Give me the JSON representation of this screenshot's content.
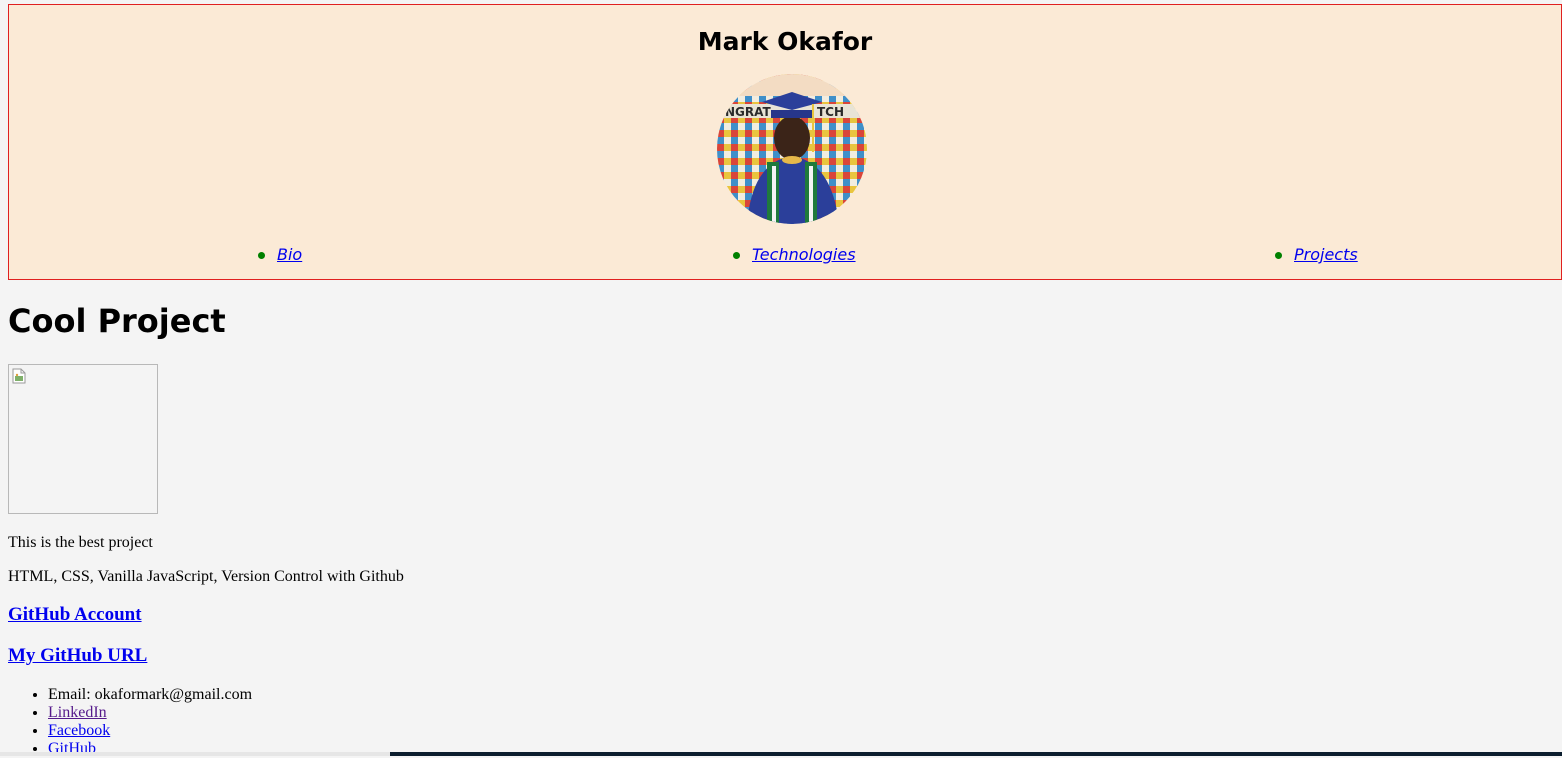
{
  "header": {
    "title": "Mark Okafor",
    "avatar_alt": "Mark Okafor in graduation cap and gown",
    "nav": [
      {
        "label": "Bio"
      },
      {
        "label": "Technologies"
      },
      {
        "label": "Projects"
      }
    ],
    "colors": {
      "background": "#fbead6",
      "border": "#e02020",
      "bullet": "#008000"
    }
  },
  "project": {
    "title": "Cool Project",
    "description": "This is the best project",
    "technologies": "HTML, CSS, Vanilla JavaScript, Version Control with Github",
    "github_account_label": "GitHub Account",
    "github_url_label": "My GitHub URL"
  },
  "contact": {
    "email": "Email: okaformark@gmail.com",
    "links": [
      {
        "label": "LinkedIn"
      },
      {
        "label": "Facebook"
      },
      {
        "label": "GitHub"
      }
    ]
  },
  "colors": {
    "page_background": "#f4f4f4",
    "link": "#0000ee",
    "visited_link": "#551a8b"
  }
}
